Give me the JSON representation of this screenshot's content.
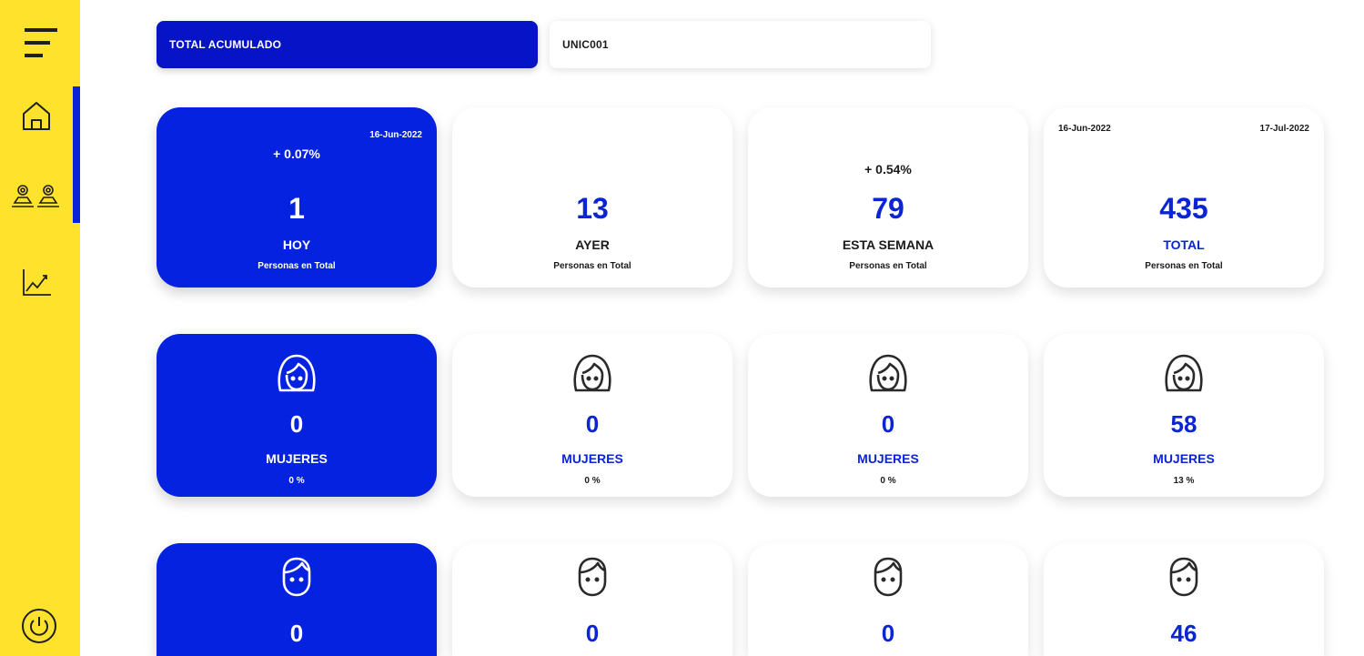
{
  "sidebar": {
    "background": "#FFE22B",
    "accent": "#0A23D6",
    "items": [
      {
        "icon": "menu-icon"
      },
      {
        "icon": "home-icon",
        "active": true
      },
      {
        "icon": "people-location-icon"
      },
      {
        "icon": "chart-line-icon"
      },
      {
        "icon": "power-icon"
      }
    ]
  },
  "header": {
    "mode_label": "TOTAL ACUMULADO",
    "unit_label": "UNIC001"
  },
  "colors": {
    "primary": "#0522E0",
    "primary_text": "#0B24D4"
  },
  "summary": [
    {
      "date": "16-Jun-2022",
      "change": "+ 0.07%",
      "value": "1",
      "label": "HOY",
      "sub": "Personas en Total"
    },
    {
      "value": "13",
      "label": "AYER",
      "sub": "Personas en Total"
    },
    {
      "change": "+ 0.54%",
      "value": "79",
      "label": "ESTA SEMANA",
      "sub": "Personas en Total"
    },
    {
      "date_start": "16-Jun-2022",
      "date_end": "17-Jul-2022",
      "value": "435",
      "label": "TOTAL",
      "sub": "Personas en Total"
    }
  ],
  "women": [
    {
      "value": "0",
      "label": "MUJERES",
      "pct": "0 %"
    },
    {
      "value": "0",
      "label": "MUJERES",
      "pct": "0 %"
    },
    {
      "value": "0",
      "label": "MUJERES",
      "pct": "0 %"
    },
    {
      "value": "58",
      "label": "MUJERES",
      "pct": "13 %"
    }
  ],
  "men": [
    {
      "value": "0"
    },
    {
      "value": "0"
    },
    {
      "value": "0"
    },
    {
      "value": "46"
    }
  ]
}
